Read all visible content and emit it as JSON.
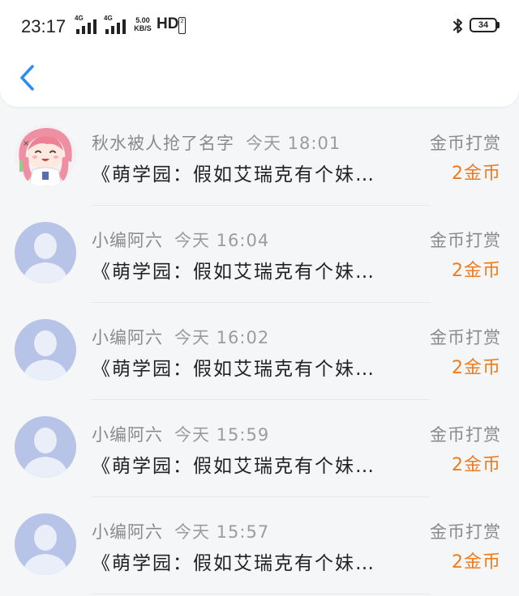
{
  "status_bar": {
    "time": "23:17",
    "signal_1_tag": "4G",
    "signal_2_tag": "4G",
    "net_speed_value": "5.00",
    "net_speed_unit": "KB/S",
    "hd_label": "HD",
    "hd_sub": "2",
    "battery_level": "34",
    "bluetooth_icon": "bluetooth-icon"
  },
  "header": {
    "back_icon": "chevron-left-icon"
  },
  "colors": {
    "accent_blue": "#2d8df0",
    "reward_orange": "#f07a1c",
    "muted_gray": "#8a8a8a"
  },
  "items": [
    {
      "name": "秋水被人抢了名字",
      "time": "今天 18:01",
      "title": "《萌学园：假如艾瑞克有个妹…",
      "reward_label": "金币打赏",
      "reward_amount": "2金币",
      "avatar": "anime-girl-avatar"
    },
    {
      "name": "小编阿六",
      "time": "今天 16:04",
      "title": "《萌学园：假如艾瑞克有个妹…",
      "reward_label": "金币打赏",
      "reward_amount": "2金币",
      "avatar": "default-avatar"
    },
    {
      "name": "小编阿六",
      "time": "今天 16:02",
      "title": "《萌学园：假如艾瑞克有个妹…",
      "reward_label": "金币打赏",
      "reward_amount": "2金币",
      "avatar": "default-avatar"
    },
    {
      "name": "小编阿六",
      "time": "今天 15:59",
      "title": "《萌学园：假如艾瑞克有个妹…",
      "reward_label": "金币打赏",
      "reward_amount": "2金币",
      "avatar": "default-avatar"
    },
    {
      "name": "小编阿六",
      "time": "今天 15:57",
      "title": "《萌学园：假如艾瑞克有个妹…",
      "reward_label": "金币打赏",
      "reward_amount": "2金币",
      "avatar": "default-avatar"
    }
  ]
}
